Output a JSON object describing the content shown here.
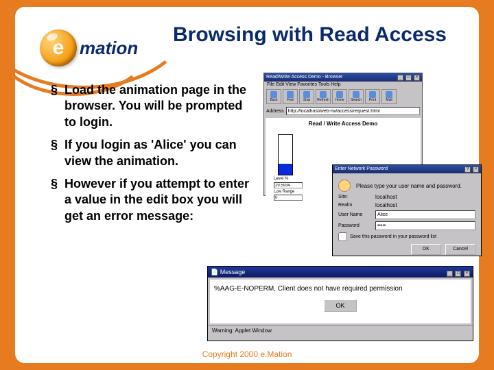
{
  "title": "Browsing with Read Access",
  "logo": {
    "letter": "e",
    "text": "mation"
  },
  "bullets": [
    "Load the animation page in the browser.  You will be prompted to login.",
    "If you login as 'Alice' you can view the animation.",
    "However if you attempt to enter a value in the edit box you will get an error message:"
  ],
  "browser": {
    "title": "Read/Write Access Demo - Browser",
    "menu": "File  Edit  View  Favorites  Tools  Help",
    "toolbar": [
      "Back",
      "Fwd",
      "Stop",
      "Refresh",
      "Home",
      "Search",
      "Print",
      "Mail"
    ],
    "address_label": "Address",
    "address": "http://localhost/web-rw/access/request.html",
    "page_title": "Read / Write Access Demo",
    "level_label": "Level %",
    "level_value": "29.5934",
    "range_label": "Low Range",
    "range_value": "0"
  },
  "login": {
    "title": "Enter Network Password",
    "prompt": "Please type your user name and password.",
    "site_label": "Site:",
    "site_value": "localhost",
    "realm_label": "Realm",
    "realm_value": "localhost",
    "user_label": "User Name",
    "user_value": "Alice",
    "password_label": "Password",
    "password_value": "•••••",
    "save_label": "Save this password in your password list",
    "ok": "OK",
    "cancel": "Cancel"
  },
  "message": {
    "title": "Message",
    "text": "%AAG-E-NOPERM, Client does not have required permission",
    "ok": "OK",
    "status": "Warning: Applet Window"
  },
  "copyright": "Copyright 2000 e.Mation"
}
